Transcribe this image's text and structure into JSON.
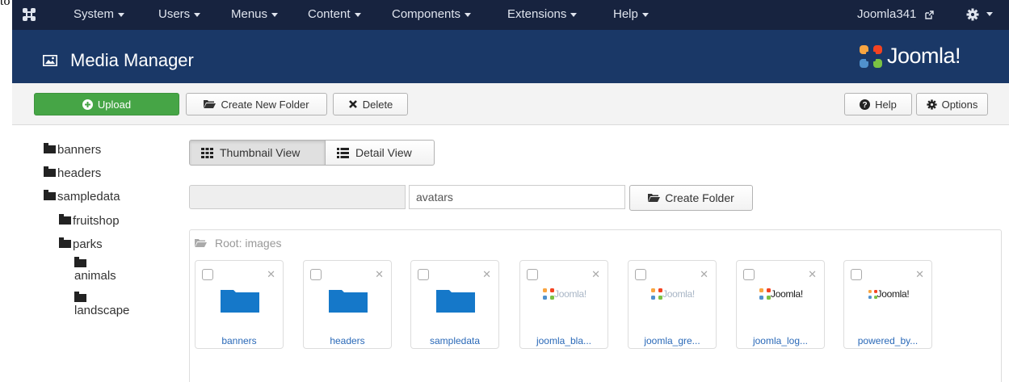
{
  "caption": "to create.",
  "navbar": {
    "menus": [
      {
        "label": "System"
      },
      {
        "label": "Users"
      },
      {
        "label": "Menus"
      },
      {
        "label": "Content"
      },
      {
        "label": "Components"
      },
      {
        "label": "Extensions"
      },
      {
        "label": "Help"
      }
    ],
    "site_name": "Joomla341",
    "bg": "#17233f"
  },
  "header": {
    "title": "Media Manager",
    "brand": "Joomla!",
    "bg": "#1a3867"
  },
  "toolbar": {
    "upload_label": "Upload",
    "new_folder_label": "Create New Folder",
    "delete_label": "Delete",
    "help_label": "Help",
    "options_label": "Options",
    "upload_color": "#46a546"
  },
  "tree": {
    "items": [
      {
        "label": "banners"
      },
      {
        "label": "headers"
      },
      {
        "label": "sampledata"
      },
      {
        "label": "fruitshop"
      },
      {
        "label": "parks"
      },
      {
        "label": "animals"
      },
      {
        "label": "landscape"
      }
    ]
  },
  "views": {
    "thumbnail_label": "Thumbnail View",
    "detail_label": "Detail View",
    "active": "thumbnail"
  },
  "folder_form": {
    "path_value": "",
    "name_value": "avatars",
    "create_label": "Create Folder"
  },
  "manager": {
    "root_label": "Root: images",
    "items": [
      {
        "label": "banners",
        "kind": "folder"
      },
      {
        "label": "headers",
        "kind": "folder"
      },
      {
        "label": "sampledata",
        "kind": "folder"
      },
      {
        "label": "joomla_bla...",
        "kind": "image",
        "image_text": "Joomla!"
      },
      {
        "label": "joomla_gre...",
        "kind": "image",
        "image_text": "Joomla!"
      },
      {
        "label": "joomla_log...",
        "kind": "image",
        "image_text": "Joomla!"
      },
      {
        "label": "powered_by...",
        "kind": "image",
        "image_text": "Joomla!"
      }
    ],
    "folder_color": "#1578c9"
  }
}
